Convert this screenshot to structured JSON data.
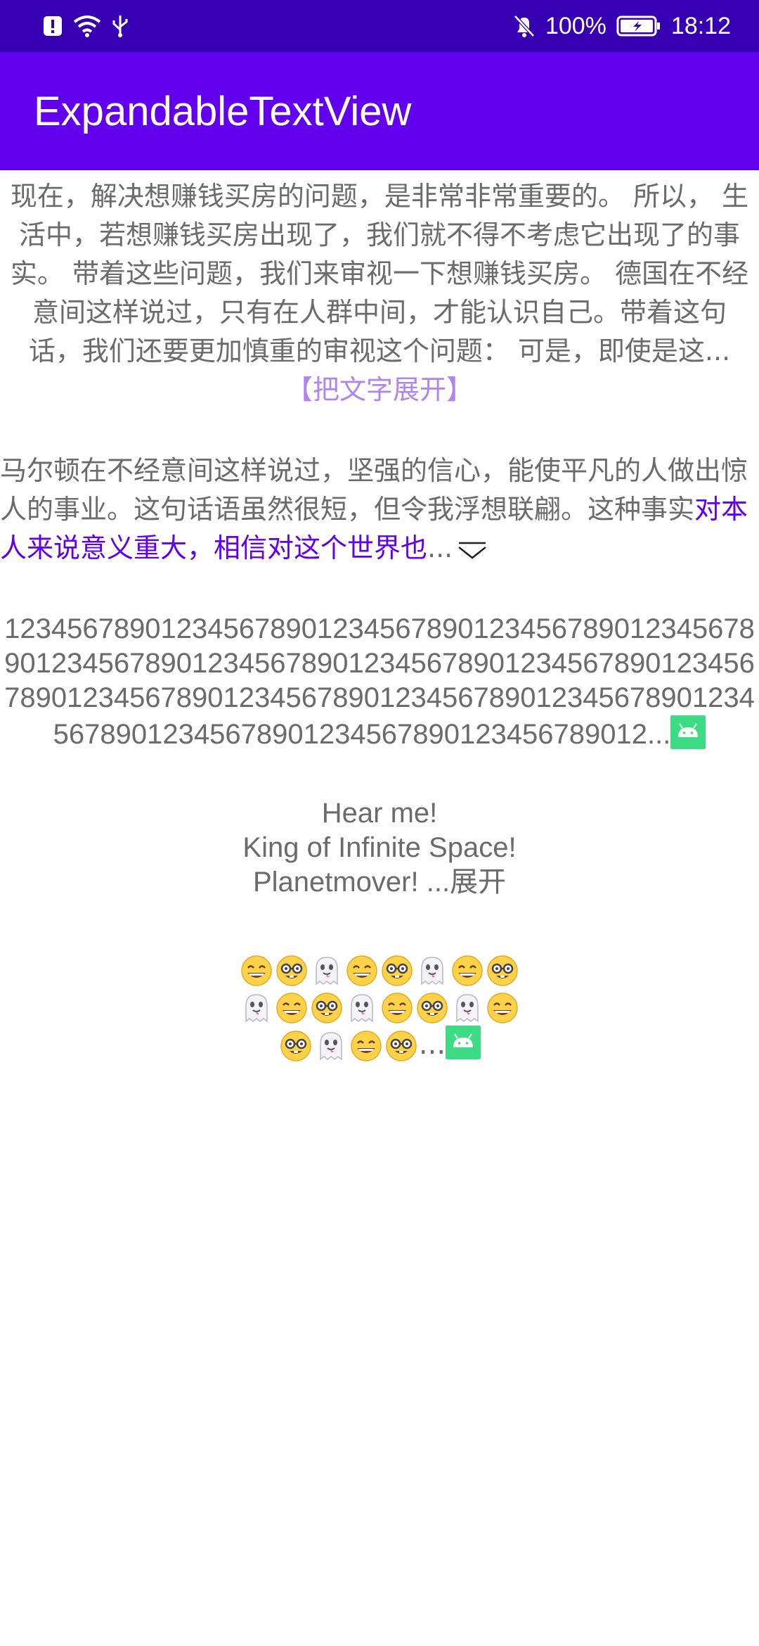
{
  "status_bar": {
    "battery": "100%",
    "time": "18:12"
  },
  "app_bar": {
    "title": "ExpandableTextView"
  },
  "text1": {
    "body": "现在，解决想赚钱买房的问题，是非常非常重要的。 所以， 生活中，若想赚钱买房出现了，我们就不得不考虑它出现了的事实。 带着这些问题，我们来审视一下想赚钱买房。 德国在不经意间这样说过，只有在人群中间，才能认识自己。带着这句话，我们还要更加慎重的审视这个问题： 可是，即使是这...",
    "expand_label": "【把文字展开】"
  },
  "text2": {
    "normal": "马尔顿在不经意间这样说过，坚强的信心，能使平凡的人做出惊人的事业。这句话语虽然很短，但令我浮想联翩。这种事实",
    "highlight": "对本人来说意义重大，相信对这个世界也",
    "ellipsis": "...",
    "expand_icon": "chevron-down-icon"
  },
  "text3": {
    "digits": "12345678901234567890123456789012345678901234567890123456789012345678901234567890123456789012345678901234567890123456789012345678901234567890123456789012345678901234567890123456789012...",
    "expand_icon": "android-icon"
  },
  "text4": {
    "line1": "Hear me!",
    "line2": "King of Infinite Space!",
    "line3": "Planetmover! ...展开"
  },
  "text5": {
    "rows": [
      [
        "grin",
        "nerd",
        "ghost",
        "grin",
        "nerd",
        "ghost",
        "grin",
        "nerd"
      ],
      [
        "ghost",
        "grin",
        "nerd",
        "ghost",
        "grin",
        "nerd",
        "ghost",
        "grin"
      ],
      [
        "nerd",
        "ghost",
        "grin",
        "nerd"
      ]
    ],
    "ellipsis": "...",
    "expand_icon": "android-icon"
  },
  "colors": {
    "status_bar": "#3700b3",
    "app_bar": "#6200ee",
    "highlight": "#6200ee",
    "expand_link": "#b185ef",
    "text": "#6b6b6b",
    "android": "#3ddc84"
  }
}
